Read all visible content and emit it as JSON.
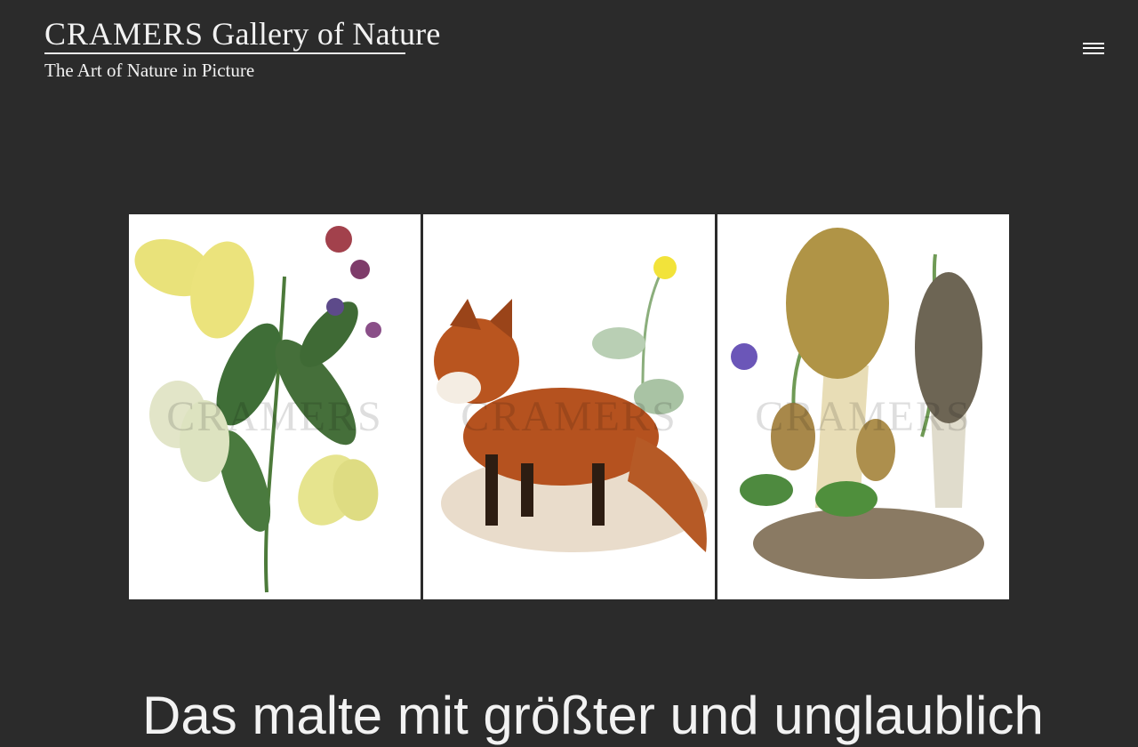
{
  "brand": {
    "name": "CRAMERS",
    "title_rest": "Gallery of Nature",
    "tagline": "The Art of Nature in Picture"
  },
  "menu": {
    "icon": "hamburger-menu-icon"
  },
  "gallery": {
    "images": [
      {
        "subject": "butterflies-and-lungwort",
        "watermark": "CRAMERS"
      },
      {
        "subject": "red-fox-with-celandine",
        "watermark": "CRAMERS"
      },
      {
        "subject": "morels-with-violets",
        "watermark": "CRAMERS"
      }
    ]
  },
  "headline": "Das malte mit größter und unglaublich"
}
